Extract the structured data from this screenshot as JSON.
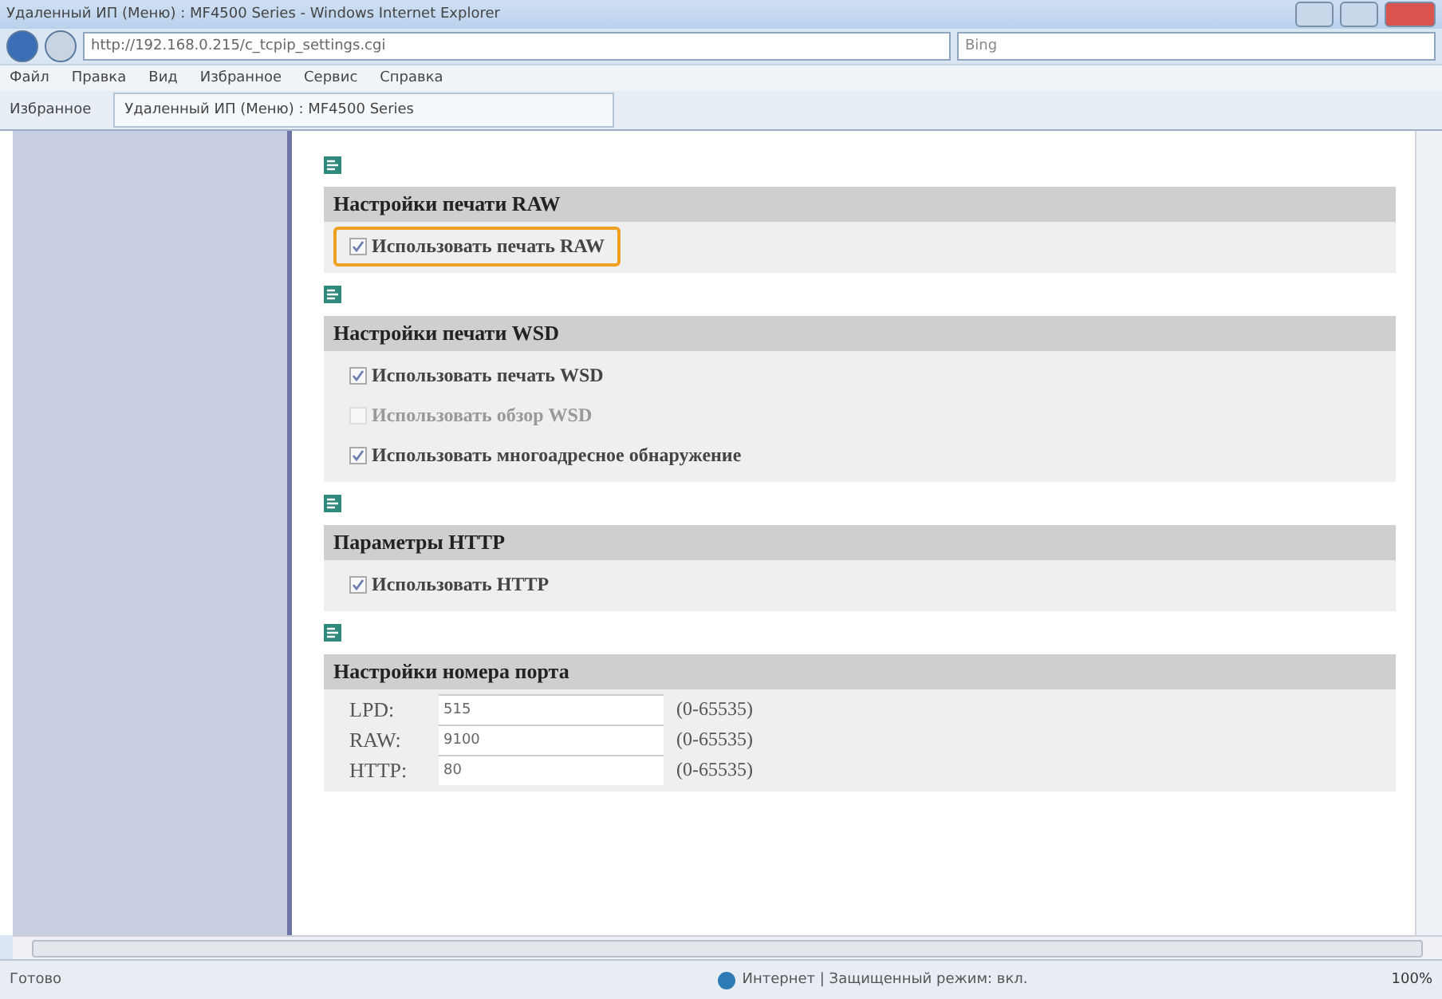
{
  "window": {
    "title": "Удаленный ИП (Меню) : MF4500 Series - Windows Internet Explorer"
  },
  "address_bar": {
    "url": "http://192.168.0.215/c_tcpip_settings.cgi",
    "search_placeholder": "Bing"
  },
  "menu": [
    "Файл",
    "Правка",
    "Вид",
    "Избранное",
    "Сервис",
    "Справка"
  ],
  "favorites_bar": {
    "favorites": "Избранное",
    "tab": "Удаленный ИП (Меню) : MF4500 Series"
  },
  "sections": [
    {
      "title": "Настройки печати RAW",
      "items": [
        {
          "kind": "checkbox",
          "label": "Использовать печать RAW",
          "checked": true,
          "disabled": false,
          "highlighted": true
        }
      ]
    },
    {
      "title": "Настройки печати WSD",
      "items": [
        {
          "kind": "checkbox",
          "label": "Использовать печать WSD",
          "checked": true,
          "disabled": false,
          "highlighted": false
        },
        {
          "kind": "checkbox",
          "label": "Использовать обзор WSD",
          "checked": false,
          "disabled": true,
          "highlighted": false
        },
        {
          "kind": "checkbox",
          "label": "Использовать многоадресное обнаружение",
          "checked": true,
          "disabled": false,
          "highlighted": false
        }
      ]
    },
    {
      "title": "Параметры HTTP",
      "items": [
        {
          "kind": "checkbox",
          "label": "Использовать HTTP",
          "checked": true,
          "disabled": false,
          "highlighted": false
        }
      ]
    },
    {
      "title": "Настройки номера порта",
      "items": [
        {
          "kind": "port",
          "label": "LPD:",
          "value": "515",
          "range": "(0-65535)"
        },
        {
          "kind": "port",
          "label": "RAW:",
          "value": "9100",
          "range": "(0-65535)"
        },
        {
          "kind": "port",
          "label": "HTTP:",
          "value": "80",
          "range": "(0-65535)"
        }
      ]
    }
  ],
  "status_bar": {
    "text": "Готово",
    "zone": "Интернет | Защищенный режим: вкл.",
    "zoom": "100%"
  }
}
